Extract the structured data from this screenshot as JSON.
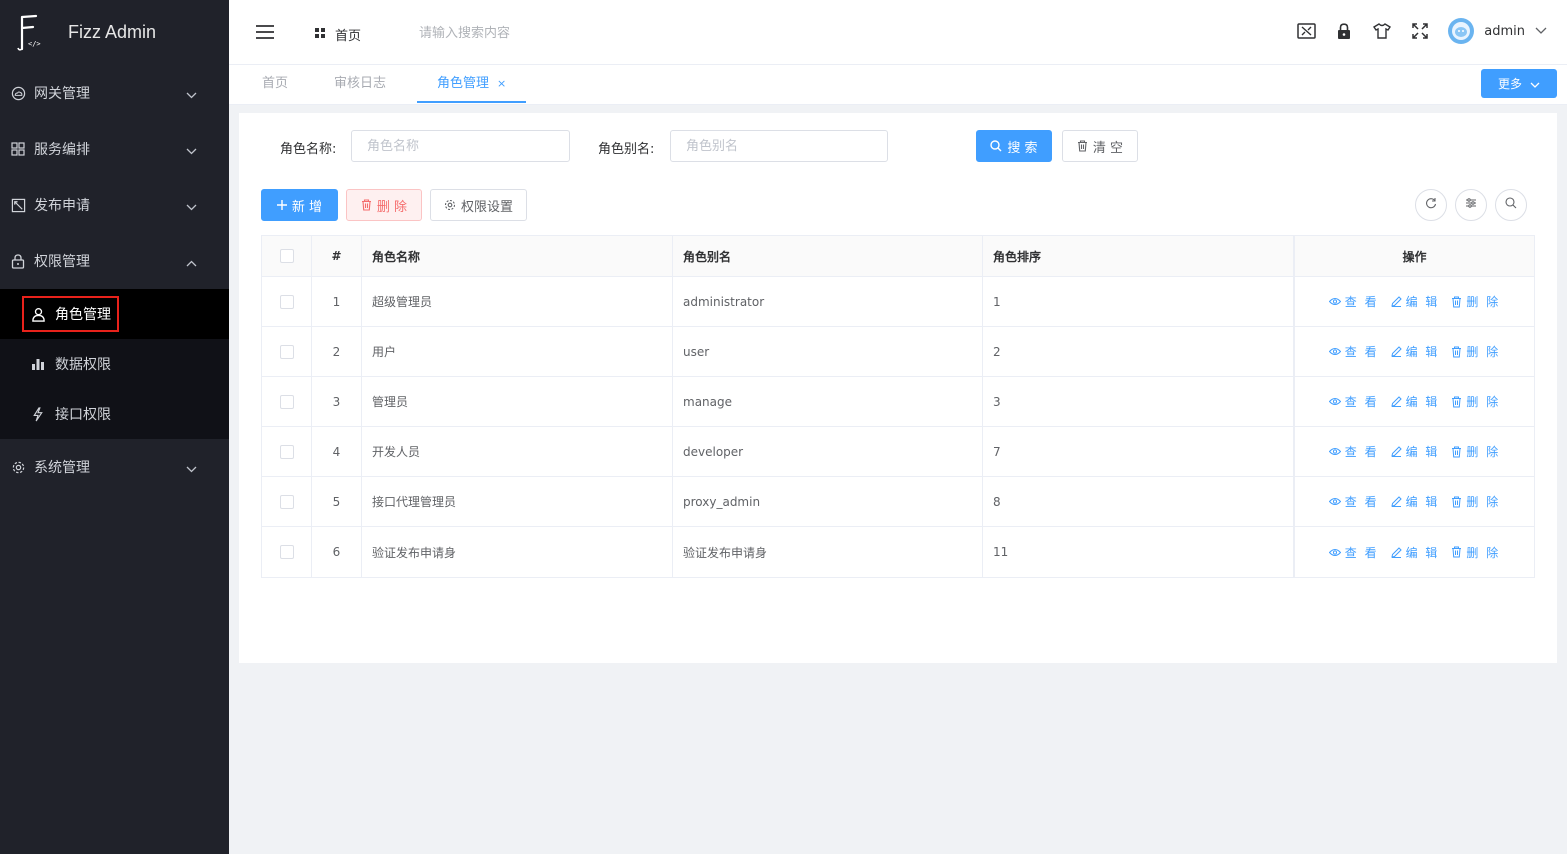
{
  "app": {
    "title": "Fizz Admin",
    "logo_letter": "F"
  },
  "sidebar": {
    "items": [
      {
        "label": "网关管理",
        "icon": "cloud-icon",
        "expanded": false
      },
      {
        "label": "服务编排",
        "icon": "grid-icon",
        "expanded": false
      },
      {
        "label": "发布申请",
        "icon": "publish-icon",
        "expanded": false
      },
      {
        "label": "权限管理",
        "icon": "lock-icon",
        "expanded": true,
        "children": [
          {
            "label": "角色管理",
            "icon": "user-icon",
            "active": true
          },
          {
            "label": "数据权限",
            "icon": "bar-chart-icon"
          },
          {
            "label": "接口权限",
            "icon": "lightning-icon"
          }
        ]
      },
      {
        "label": "系统管理",
        "icon": "gear-icon",
        "expanded": false
      }
    ]
  },
  "header": {
    "home_label": "首页",
    "search_placeholder": "请输入搜索内容",
    "username": "admin"
  },
  "tabs": {
    "items": [
      {
        "label": "首页"
      },
      {
        "label": "审核日志"
      },
      {
        "label": "角色管理",
        "active": true,
        "close": "×"
      }
    ],
    "more_label": "更多"
  },
  "search_form": {
    "role_name_label": "角色名称:",
    "role_name_placeholder": "角色名称",
    "role_alias_label": "角色别名:",
    "role_alias_placeholder": "角色别名",
    "search_label": "搜 索",
    "clear_label": "清 空"
  },
  "toolbar": {
    "add_label": "新 增",
    "delete_label": "删 除",
    "permission_label": "权限设置"
  },
  "table": {
    "columns": [
      "#",
      "角色名称",
      "角色别名",
      "角色排序",
      "操作"
    ],
    "actions": {
      "view": "查 看",
      "edit": "编 辑",
      "delete": "删 除"
    },
    "rows": [
      {
        "index": "1",
        "name": "超级管理员",
        "alias": "administrator",
        "sort": "1"
      },
      {
        "index": "2",
        "name": "用户",
        "alias": "user",
        "sort": "2"
      },
      {
        "index": "3",
        "name": "管理员",
        "alias": "manage",
        "sort": "3"
      },
      {
        "index": "4",
        "name": "开发人员",
        "alias": "developer",
        "sort": "7"
      },
      {
        "index": "5",
        "name": "接口代理管理员",
        "alias": "proxy_admin",
        "sort": "8"
      },
      {
        "index": "6",
        "name": "验证发布申请身",
        "alias": "验证发布申请身",
        "sort": "11"
      }
    ]
  },
  "colors": {
    "sidebar_bg": "#20222a",
    "accent": "#409eff",
    "danger": "#f56c6c",
    "highlight_box": "#e8221b"
  }
}
